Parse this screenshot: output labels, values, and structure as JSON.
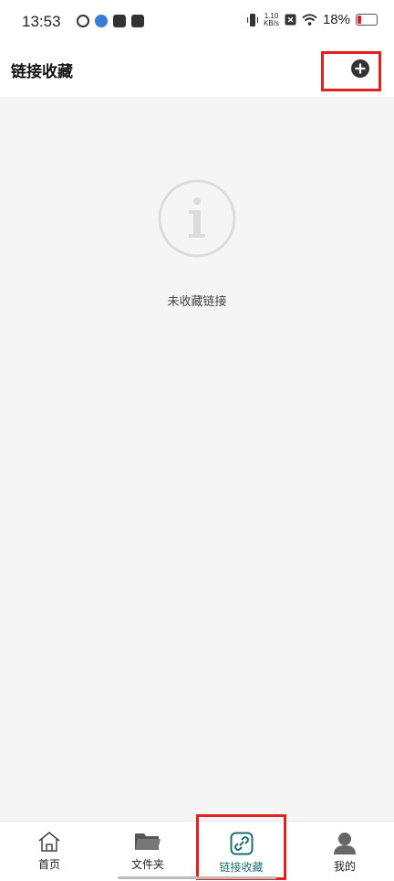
{
  "status_bar": {
    "time": "13:53",
    "net_speed_value": "1.10",
    "net_speed_unit": "KB/s",
    "battery": "18%",
    "battery_color": "#e02020"
  },
  "header": {
    "title": "链接收藏",
    "add_icon": "plus-circle-icon"
  },
  "empty_state": {
    "icon": "info-icon",
    "message": "未收藏链接"
  },
  "bottom_nav": {
    "items": [
      {
        "label": "首页",
        "icon": "home-icon"
      },
      {
        "label": "文件夹",
        "icon": "folder-icon"
      },
      {
        "label": "链接收藏",
        "icon": "link-icon",
        "active": true
      },
      {
        "label": "我的",
        "icon": "person-icon"
      }
    ],
    "active_color": "#1d6e73"
  }
}
